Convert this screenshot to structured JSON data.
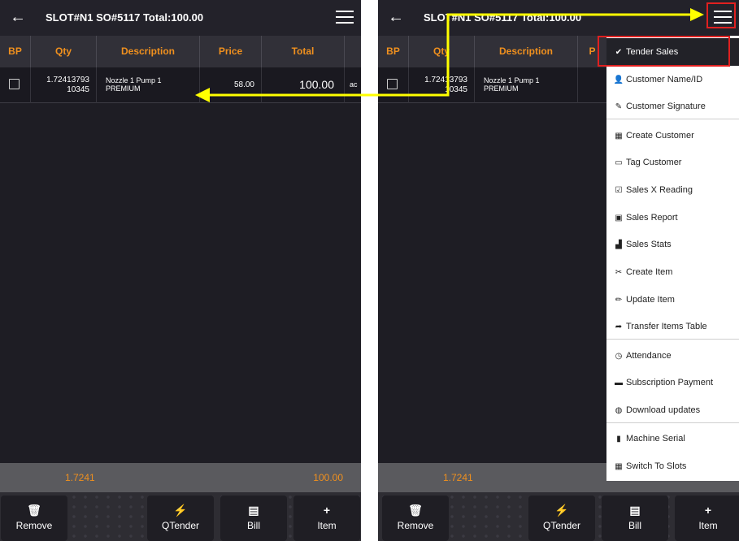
{
  "screen": {
    "title": "SLOT#N1 SO#5117 Total:100.00",
    "back_icon": "←",
    "columns": [
      "BP",
      "Qty",
      "Description",
      "Price",
      "Total"
    ],
    "right_columns": [
      "BP",
      "Qty",
      "Description",
      "P"
    ],
    "row": {
      "qty_line1": "1.72413793",
      "qty_line2": "10345",
      "desc_line1": "Nozzle 1 Pump 1",
      "desc_line2": "PREMIUM",
      "price": "58.00",
      "total": "100.00",
      "extra": "ac"
    },
    "footer": {
      "qty": "1.7241",
      "total": "100.00"
    },
    "buttons": [
      {
        "icon": "🗑",
        "label": "Remove"
      },
      {
        "icon": "⚡",
        "label": "QTender"
      },
      {
        "icon": "▤",
        "label": "Bill"
      },
      {
        "icon": "+",
        "label": "Item"
      }
    ]
  },
  "menu": {
    "items": [
      {
        "icon": "✔",
        "label": "Tender Sales"
      },
      {
        "icon": "👤",
        "label": "Customer Name/ID"
      },
      {
        "icon": "✎",
        "label": "Customer Signature"
      },
      {
        "icon": "▦",
        "label": "Create Customer"
      },
      {
        "icon": "▭",
        "label": "Tag Customer"
      },
      {
        "icon": "☑",
        "label": "Sales X Reading"
      },
      {
        "icon": "▣",
        "label": "Sales Report"
      },
      {
        "icon": "▟",
        "label": "Sales Stats"
      },
      {
        "icon": "✂",
        "label": "Create Item"
      },
      {
        "icon": "✏",
        "label": "Update Item"
      },
      {
        "icon": "➦",
        "label": "Transfer Items Table"
      },
      {
        "icon": "◷",
        "label": "Attendance"
      },
      {
        "icon": "▬",
        "label": "Subscription Payment"
      },
      {
        "icon": "◍",
        "label": "Download updates"
      },
      {
        "icon": "▮",
        "label": "Machine Serial"
      },
      {
        "icon": "▦",
        "label": "Switch To Slots"
      }
    ]
  },
  "colors": {
    "accent": "#f0901e",
    "annotation_arrow": "#ffff00",
    "highlight_box": "#e02020"
  }
}
